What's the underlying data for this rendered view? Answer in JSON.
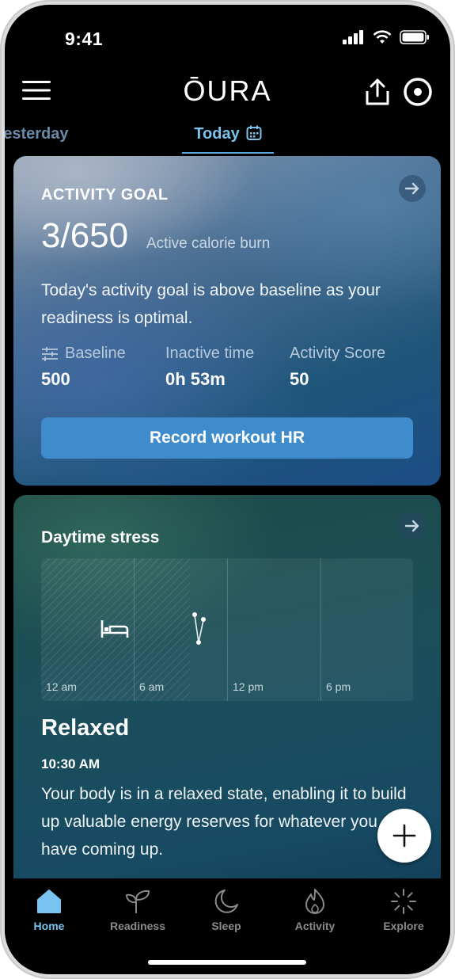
{
  "status_bar": {
    "time": "9:41"
  },
  "header": {
    "logo": "ŌURA"
  },
  "day_tabs": {
    "previous": "Yesterday",
    "current": "Today"
  },
  "activity_card": {
    "label": "ACTIVITY GOAL",
    "progress": "3/650",
    "progress_unit": "Active calorie burn",
    "description": "Today's activity goal is above baseline as your readiness is optimal.",
    "stats": [
      {
        "label": "Baseline",
        "value": "500"
      },
      {
        "label": "Inactive time",
        "value": "0h 53m"
      },
      {
        "label": "Activity Score",
        "value": "50"
      }
    ],
    "button_label": "Record workout HR"
  },
  "stress_card": {
    "title": "Daytime stress",
    "chart_ticks": [
      "12 am",
      "6 am",
      "12 pm",
      "6 pm"
    ],
    "state": "Relaxed",
    "time": "10:30 AM",
    "description": "Your body is in a relaxed state, enabling it to build up valuable energy reserves for whatever you have coming up."
  },
  "nav": [
    {
      "label": "Home",
      "icon": "home-icon",
      "active": true
    },
    {
      "label": "Readiness",
      "icon": "sprout-icon",
      "active": false
    },
    {
      "label": "Sleep",
      "icon": "moon-icon",
      "active": false
    },
    {
      "label": "Activity",
      "icon": "flame-icon",
      "active": false
    },
    {
      "label": "Explore",
      "icon": "burst-icon",
      "active": false
    }
  ],
  "colors": {
    "accent": "#79c3f0",
    "button": "#3f8ccc",
    "background": "#000000"
  }
}
